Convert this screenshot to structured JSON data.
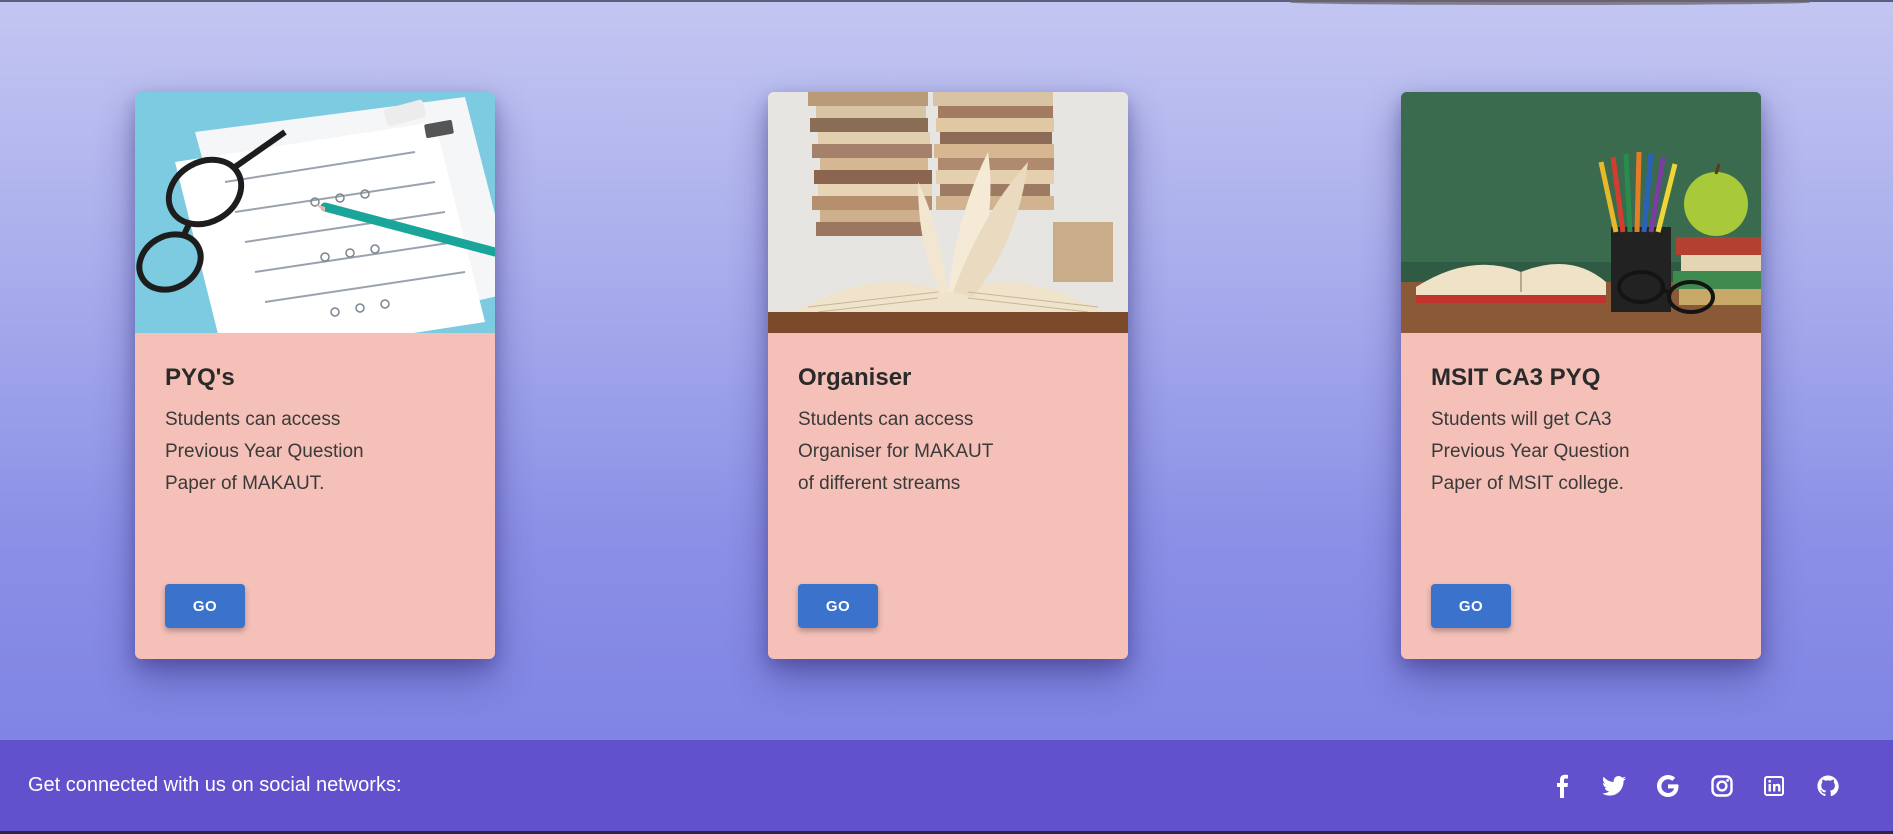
{
  "cards": [
    {
      "title": "PYQ's",
      "description": "Students can access Previous Year Question Paper of MAKAUT.",
      "button_label": "GO",
      "image": "exam-paper-with-glasses-image"
    },
    {
      "title": "Organiser",
      "description": "Students can access Organiser for MAKAUT of different streams",
      "button_label": "GO",
      "image": "stack-of-books-image"
    },
    {
      "title": "MSIT CA3 PYQ",
      "description": "Students will get CA3 Previous Year Question Paper of MSIT college.",
      "button_label": "GO",
      "image": "books-pencils-apple-image"
    }
  ],
  "footer": {
    "connect_text": "Get connected with us on social networks:",
    "social_icons": [
      "facebook-icon",
      "twitter-icon",
      "google-icon",
      "instagram-icon",
      "linkedin-icon",
      "github-icon"
    ]
  },
  "colors": {
    "card_background": "#f4c0b7",
    "button": "#3b72cc",
    "footer": "#6251cc"
  }
}
